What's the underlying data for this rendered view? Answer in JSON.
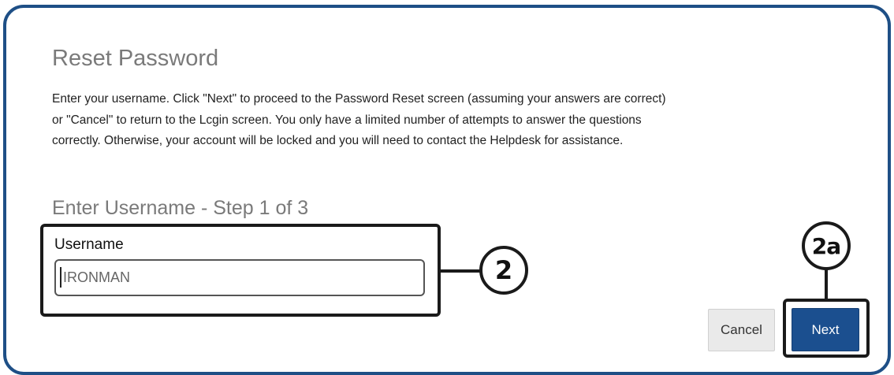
{
  "reset": {
    "title": "Reset Password",
    "description_lines": [
      "Enter your username. Click \"Next\" to proceed to the Password Reset screen (assuming your answers are correct)",
      "or \"Cancel\" to return to the Lcgin screen. You only have a limited number of attempts to answer the questions",
      "correctly. Otherwise, your account will be locked and you will need to contact the Helpdesk for assistance."
    ],
    "step_title": "Enter Username - Step 1 of 3",
    "username": {
      "label": "Username",
      "value": "IRONMAN"
    },
    "buttons": {
      "cancel": "Cancel",
      "next": "Next"
    }
  },
  "callouts": {
    "username_marker": "2",
    "next_marker": "2a"
  },
  "colors": {
    "frame_border": "#1e4f86",
    "next_button": "#1b4f8f",
    "heading_gray": "#7a7a7a"
  }
}
